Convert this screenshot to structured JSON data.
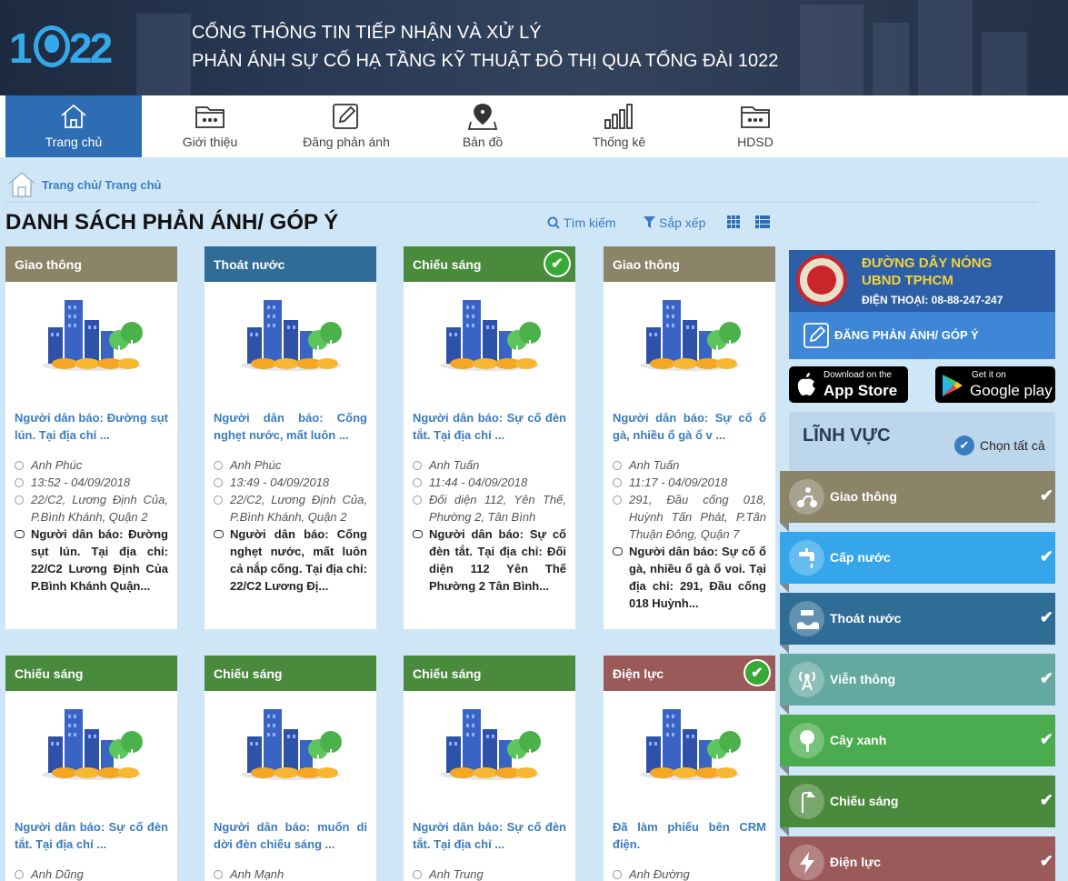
{
  "header": {
    "logo_part1": "1",
    "logo_part2": "22",
    "title_line1": "CỔNG THÔNG TIN TIẾP NHẬN VÀ XỬ LÝ",
    "title_line2": "PHẢN ÁNH SỰ CỐ HẠ TẦNG KỸ THUẬT ĐÔ THỊ QUA TỔNG ĐÀI 1022"
  },
  "nav": [
    {
      "label": "Trang chủ",
      "icon": "home-icon",
      "active": true
    },
    {
      "label": "Giới thiệu",
      "icon": "folder-icon",
      "active": false
    },
    {
      "label": "Đăng phản ánh",
      "icon": "edit-icon",
      "active": false
    },
    {
      "label": "Bản đồ",
      "icon": "map-pin-icon",
      "active": false
    },
    {
      "label": "Thống kê",
      "icon": "bar-chart-icon",
      "active": false
    },
    {
      "label": "HDSD",
      "icon": "folder-icon",
      "active": false
    }
  ],
  "breadcrumb": "Trang chủ/ Trang chủ",
  "page_title": "DANH SÁCH PHẢN ÁNH/ GÓP Ý",
  "toolbar": {
    "search": "Tìm kiếm",
    "sort": "Sắp xếp"
  },
  "cards": [
    {
      "category": "Giao thông",
      "color": "#8b8468",
      "done": false,
      "title": "Người dân báo: Đường sụt lún. Tại địa chỉ ...",
      "author": "Anh Phúc",
      "time": "13:52 - 04/09/2018",
      "address": "22/C2, Lương Định Của, P.Bình Khánh, Quận 2",
      "desc": "Người dân báo: Đường sụt lún. Tại địa chỉ: 22/C2 Lương Định Của P.Bình Khánh Quận..."
    },
    {
      "category": "Thoát nước",
      "color": "#2f6c96",
      "done": false,
      "title": "Người dân báo: Cống nghẹt nước, mất luôn ...",
      "author": "Anh Phúc",
      "time": "13:49 - 04/09/2018",
      "address": "22/C2, Lương Định Của, P.Bình Khánh, Quận 2",
      "desc": "Người dân báo: Cống nghẹt nước, mất luôn cả nắp cống. Tại địa chỉ: 22/C2 Lương Đị..."
    },
    {
      "category": "Chiếu sáng",
      "color": "#4a8a3c",
      "done": true,
      "title": "Người dân báo: Sự cố đèn tắt. Tại địa chỉ ...",
      "author": "Anh Tuấn",
      "time": "11:44 - 04/09/2018",
      "address": "Đối diện 112, Yên Thế, Phường 2, Tân Bình",
      "desc": "Người dân báo: Sự cố đèn tắt. Tại địa chỉ: Đối diện 112 Yên Thế Phường 2 Tân Bình..."
    },
    {
      "category": "Giao thông",
      "color": "#8b8468",
      "done": false,
      "title": "Người dân báo: Sự cố ổ gà, nhiều ổ gà ổ v ...",
      "author": "Anh Tuấn",
      "time": "11:17 - 04/09/2018",
      "address": "291, Đầu cống 018, Huỳnh Tấn Phát, P.Tân Thuận Đông, Quận 7",
      "desc": "Người dân báo: Sự cố ổ gà, nhiều ổ gà ổ voi. Tại địa chỉ: 291, Đầu cống 018 Huỳnh..."
    },
    {
      "category": "Chiếu sáng",
      "color": "#4a8a3c",
      "done": false,
      "title": "Người dân báo: Sự cố đèn tắt. Tại địa chỉ ...",
      "author": "Anh Dũng",
      "time": "",
      "address": "",
      "desc": ""
    },
    {
      "category": "Chiếu sáng",
      "color": "#4a8a3c",
      "done": false,
      "title": "Người dân báo: muốn di dời đèn chiếu sáng ...",
      "author": "Anh Mạnh",
      "time": "",
      "address": "",
      "desc": ""
    },
    {
      "category": "Chiếu sáng",
      "color": "#4a8a3c",
      "done": false,
      "title": "Người dân báo: Sự cố đèn tắt. Tại địa chỉ ...",
      "author": "Anh Trung",
      "time": "",
      "address": "",
      "desc": ""
    },
    {
      "category": "Điện lực",
      "color": "#9b5a5a",
      "done": true,
      "title": "Đã làm phiếu bên CRM điện.",
      "author": "Anh Đường",
      "time": "",
      "address": "",
      "desc": ""
    }
  ],
  "hotline": {
    "line1": "ĐƯỜNG DÂY NÓNG",
    "line2": "UBND TPHCM",
    "phone": "ĐIỆN THOẠI: 08-88-247-247"
  },
  "report_button": "ĐĂNG PHẢN ÁNH/ GÓP Ý",
  "app_store": {
    "small": "Download on the",
    "big": "App Store"
  },
  "google_play": {
    "small": "Get it on",
    "big": "Google play"
  },
  "fields": {
    "title": "LĨNH VỰC",
    "select_all": "Chọn tất cả",
    "items": [
      {
        "label": "Giao thông",
        "color": "#8b8468",
        "icon": "motorbike-icon"
      },
      {
        "label": "Cấp nước",
        "color": "#35a6ea",
        "icon": "water-tap-icon"
      },
      {
        "label": "Thoát nước",
        "color": "#2f6c96",
        "icon": "drainage-icon"
      },
      {
        "label": "Viễn thông",
        "color": "#64a9a0",
        "icon": "antenna-icon"
      },
      {
        "label": "Cây xanh",
        "color": "#4aac4e",
        "icon": "tree-icon"
      },
      {
        "label": "Chiếu sáng",
        "color": "#4a8a3c",
        "icon": "street-light-icon"
      },
      {
        "label": "Điện lực",
        "color": "#9b5a5a",
        "icon": "lightning-icon"
      }
    ]
  }
}
